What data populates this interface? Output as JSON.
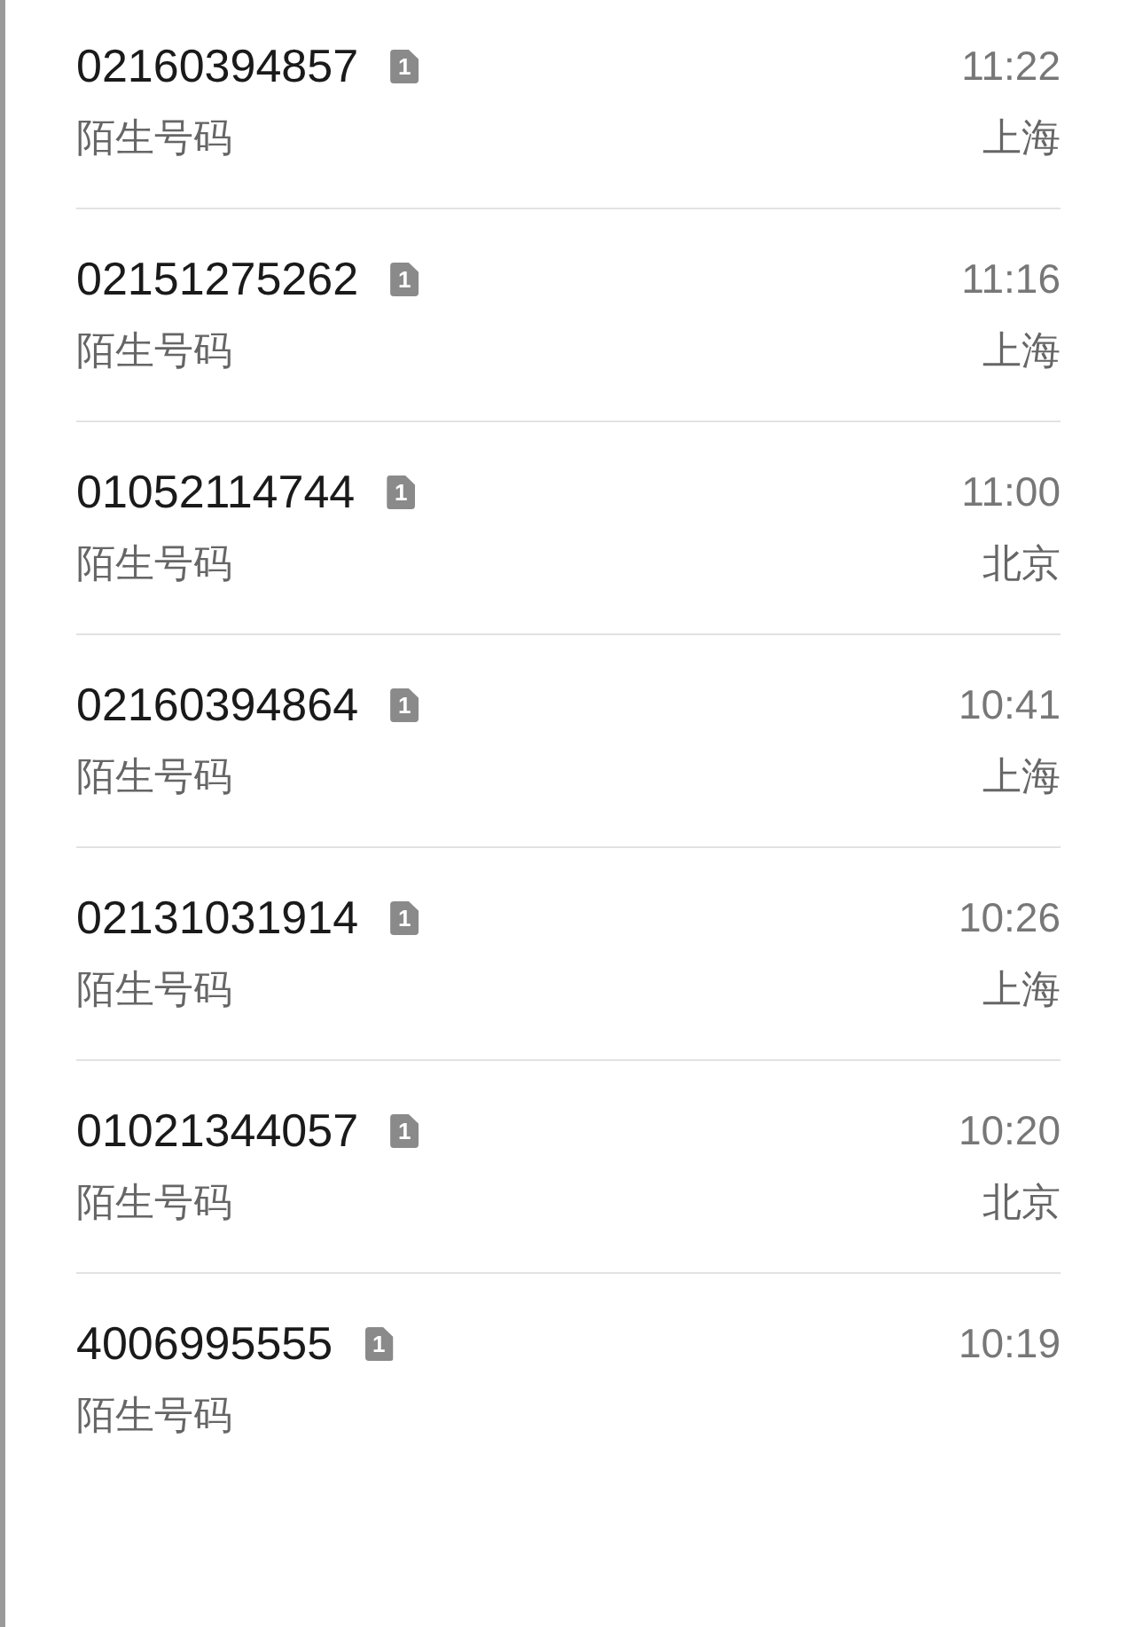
{
  "calls": [
    {
      "number": "02160394857",
      "sim": "1",
      "label": "陌生号码",
      "time": "11:22",
      "location": "上海"
    },
    {
      "number": "02151275262",
      "sim": "1",
      "label": "陌生号码",
      "time": "11:16",
      "location": "上海"
    },
    {
      "number": "01052114744",
      "sim": "1",
      "label": "陌生号码",
      "time": "11:00",
      "location": "北京"
    },
    {
      "number": "02160394864",
      "sim": "1",
      "label": "陌生号码",
      "time": "10:41",
      "location": "上海"
    },
    {
      "number": "02131031914",
      "sim": "1",
      "label": "陌生号码",
      "time": "10:26",
      "location": "上海"
    },
    {
      "number": "01021344057",
      "sim": "1",
      "label": "陌生号码",
      "time": "10:20",
      "location": "北京"
    },
    {
      "number": "4006995555",
      "sim": "1",
      "label": "陌生号码",
      "time": "10:19"
    }
  ]
}
